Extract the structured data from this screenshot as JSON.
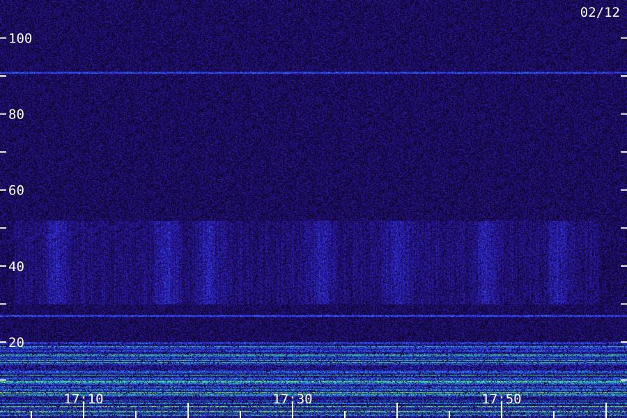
{
  "chart_data": {
    "type": "heatmap",
    "date_label": "02/12",
    "y_axis": {
      "range": [
        0,
        110
      ],
      "major_ticks": [
        10,
        20,
        30,
        40,
        50,
        60,
        70,
        80,
        90,
        100
      ],
      "labeled_ticks": [
        {
          "value": 20,
          "label": "20"
        },
        {
          "value": 40,
          "label": "40"
        },
        {
          "value": 60,
          "label": "60"
        },
        {
          "value": 80,
          "label": "80"
        },
        {
          "value": 100,
          "label": "100"
        }
      ]
    },
    "x_axis": {
      "range": [
        "17:02",
        "17:62"
      ],
      "ticks": [
        "17:05",
        "17:10",
        "17:15",
        "17:20",
        "17:25",
        "17:30",
        "17:35",
        "17:40",
        "17:45",
        "17:50",
        "17:55",
        "17:60"
      ],
      "labeled_ticks": [
        {
          "value": "17:10",
          "label": "17:10"
        },
        {
          "value": "17:30",
          "label": "17:30"
        },
        {
          "value": "17:50",
          "label": "17:50"
        }
      ]
    },
    "colormap": [
      "#000000",
      "#1a0a4a",
      "#2a18b0",
      "#3050ff",
      "#20c0c0",
      "#40ff60",
      "#ffff40"
    ],
    "features": [
      {
        "kind": "horizontal-line",
        "y": 91,
        "color": "#4060ff"
      },
      {
        "kind": "horizontal-line",
        "y": 27,
        "color": "#3050ff"
      },
      {
        "kind": "bright-band",
        "y_range": [
          0,
          20
        ],
        "color": "#40ff60"
      },
      {
        "kind": "diffuse-band",
        "y_range": [
          30,
          52
        ],
        "color": "#2a30d0"
      }
    ]
  }
}
